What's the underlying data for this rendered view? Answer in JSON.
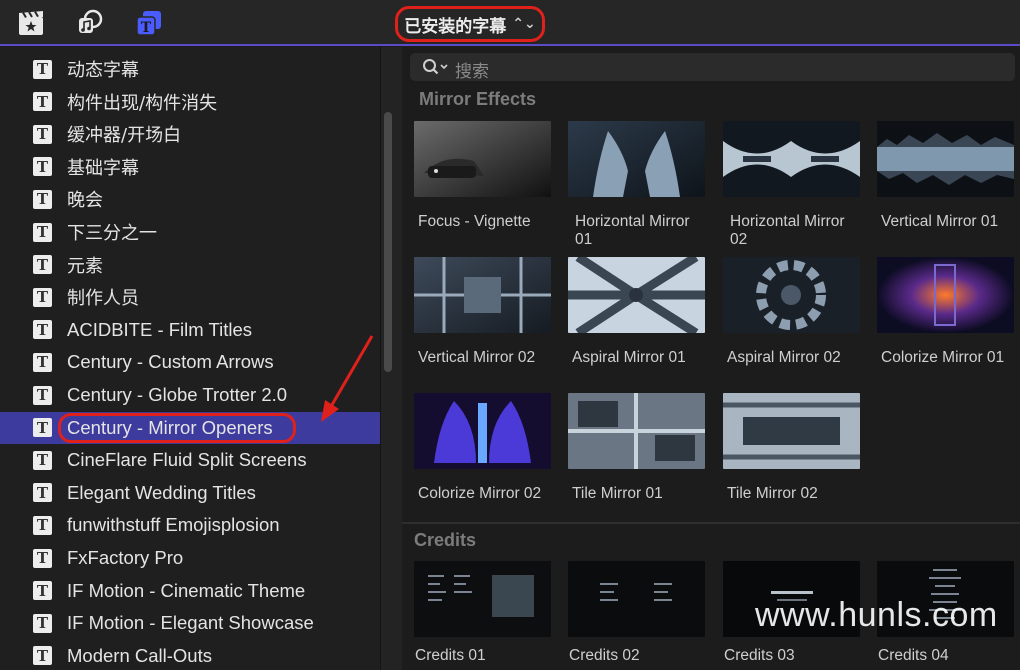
{
  "toolbar": {
    "selector_label": "已安装的字幕",
    "icons": [
      "clapper-star-icon",
      "music-photo-icon",
      "titles-icon"
    ]
  },
  "sidebar": {
    "items": [
      {
        "label": "动态字幕"
      },
      {
        "label": "构件出现/构件消失"
      },
      {
        "label": "缓冲器/开场白"
      },
      {
        "label": "基础字幕"
      },
      {
        "label": "晚会"
      },
      {
        "label": "下三分之一"
      },
      {
        "label": "元素"
      },
      {
        "label": "制作人员"
      },
      {
        "label": "ACIDBITE - Film Titles"
      },
      {
        "label": "Century - Custom Arrows"
      },
      {
        "label": "Century - Globe Trotter 2.0"
      },
      {
        "label": "Century - Mirror Openers"
      },
      {
        "label": "CineFlare Fluid Split Screens"
      },
      {
        "label": "Elegant Wedding Titles"
      },
      {
        "label": "funwithstuff Emojisplosion"
      },
      {
        "label": "FxFactory Pro"
      },
      {
        "label": "IF Motion - Cinematic Theme"
      },
      {
        "label": "IF Motion - Elegant Showcase"
      },
      {
        "label": "Modern Call-Outs"
      }
    ],
    "selected_index": 11,
    "item_icon": "T"
  },
  "search": {
    "placeholder": "搜索"
  },
  "sections": [
    {
      "title": "Mirror Effects",
      "items": [
        {
          "caption": "Focus - Vignette"
        },
        {
          "caption": "Horizontal Mirror 01"
        },
        {
          "caption": "Horizontal Mirror 02"
        },
        {
          "caption": "Vertical Mirror 01"
        },
        {
          "caption": "Vertical Mirror 02"
        },
        {
          "caption": "Aspiral Mirror 01"
        },
        {
          "caption": "Aspiral Mirror 02"
        },
        {
          "caption": "Colorize Mirror 01"
        },
        {
          "caption": "Colorize Mirror 02"
        },
        {
          "caption": "Tile Mirror 01"
        },
        {
          "caption": "Tile Mirror 02"
        }
      ]
    },
    {
      "title": "Credits",
      "items": [
        {
          "caption": "Credits 01"
        },
        {
          "caption": "Credits 02"
        },
        {
          "caption": "Credits 03"
        },
        {
          "caption": "Credits 04"
        }
      ]
    }
  ],
  "watermark": "www.hunls.com",
  "colors": {
    "accent": "#5a4cc9",
    "selection": "#3e3b9e",
    "highlight": "#e0211b"
  }
}
